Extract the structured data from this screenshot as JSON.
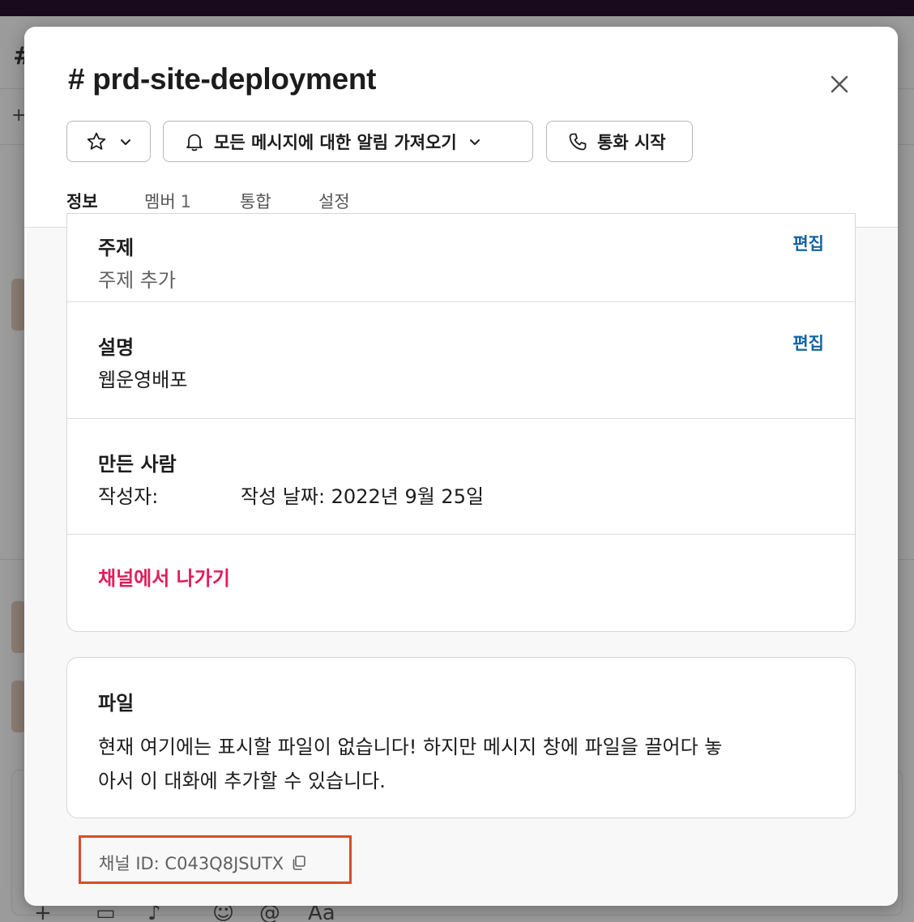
{
  "background": {
    "hash": "#",
    "plus": "+",
    "toolbar_icons": [
      "plus-icon",
      "video-icon",
      "microphone-icon",
      "emoji-icon",
      "mention-icon",
      "format-icon"
    ],
    "toolbar_glyphs": [
      "+",
      "▭",
      "♪",
      "☺",
      "@",
      "Aa"
    ]
  },
  "modal": {
    "title": "# prd-site-deployment",
    "close_icon": "close-icon",
    "buttons": {
      "star_icon": "star-icon",
      "notification_label": "모든 메시지에 대한 알림 가져오기",
      "call_label": "통화 시작"
    },
    "tabs": [
      {
        "label": "정보",
        "count": "",
        "active": true
      },
      {
        "label": "멤버",
        "count": "1",
        "active": false
      },
      {
        "label": "통합",
        "count": "",
        "active": false
      },
      {
        "label": "설정",
        "count": "",
        "active": false
      }
    ],
    "about": {
      "topic": {
        "label": "주제",
        "value": "주제 추가",
        "edit": "편집"
      },
      "description": {
        "label": "설명",
        "value": "웹운영배포",
        "edit": "편집"
      },
      "creator": {
        "label": "만든 사람",
        "author_label": "작성자:",
        "date_text": "작성 날짜: 2022년 9월 25일"
      },
      "leave": "채널에서 나가기"
    },
    "files": {
      "label": "파일",
      "line1": "현재 여기에는 표시할 파일이 없습니다! 하지만 메시지 창에 파일을 끌어다 놓",
      "line2": "아서 이 대화에 추가할 수 있습니다."
    },
    "channel_id": "채널 ID: C043Q8JSUTX"
  },
  "colors": {
    "accent_tab": "#1b7a57",
    "link": "#1264a3",
    "danger": "#e01e5a",
    "highlight_box": "#e0492b"
  }
}
